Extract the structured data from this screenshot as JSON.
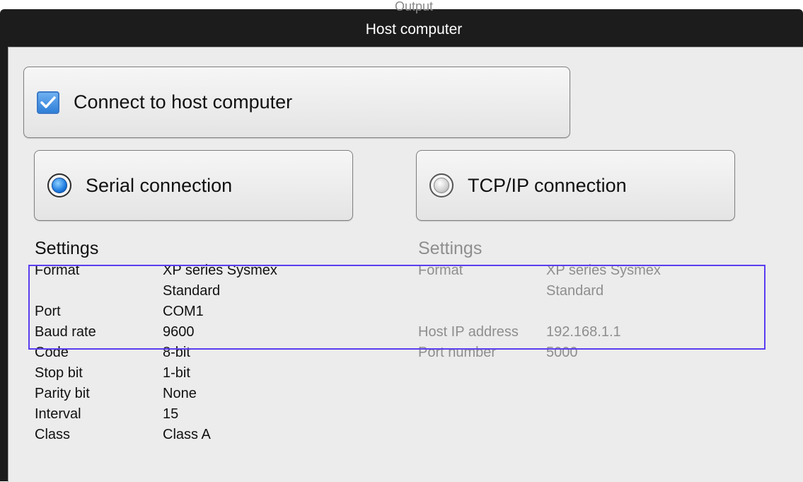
{
  "window": {
    "behind_title": "Output",
    "title": "Host computer"
  },
  "connect": {
    "label": "Connect to host computer",
    "checked": true
  },
  "serial": {
    "label": "Serial connection",
    "selected": true,
    "settings_title": "Settings",
    "rows": [
      {
        "label": "Format",
        "value": "XP series Sysmex Standard"
      },
      {
        "label": "Port",
        "value": "COM1"
      },
      {
        "label": "Baud rate",
        "value": "9600"
      },
      {
        "label": "Code",
        "value": "8-bit"
      },
      {
        "label": "Stop bit",
        "value": "1-bit"
      },
      {
        "label": "Parity bit",
        "value": "None"
      },
      {
        "label": "Interval",
        "value": "15"
      },
      {
        "label": "Class",
        "value": "Class A"
      }
    ]
  },
  "tcp": {
    "label": "TCP/IP connection",
    "selected": false,
    "settings_title": "Settings",
    "rows": [
      {
        "label": "Format",
        "value": "XP series Sysmex Standard"
      },
      {
        "label": "Host IP address",
        "value": "192.168.1.1"
      },
      {
        "label": "Port number",
        "value": "5000"
      }
    ]
  },
  "colors": {
    "highlight": "#5b3df0",
    "accent": "#1e7be0",
    "disabled_text": "#8e8e8e"
  }
}
